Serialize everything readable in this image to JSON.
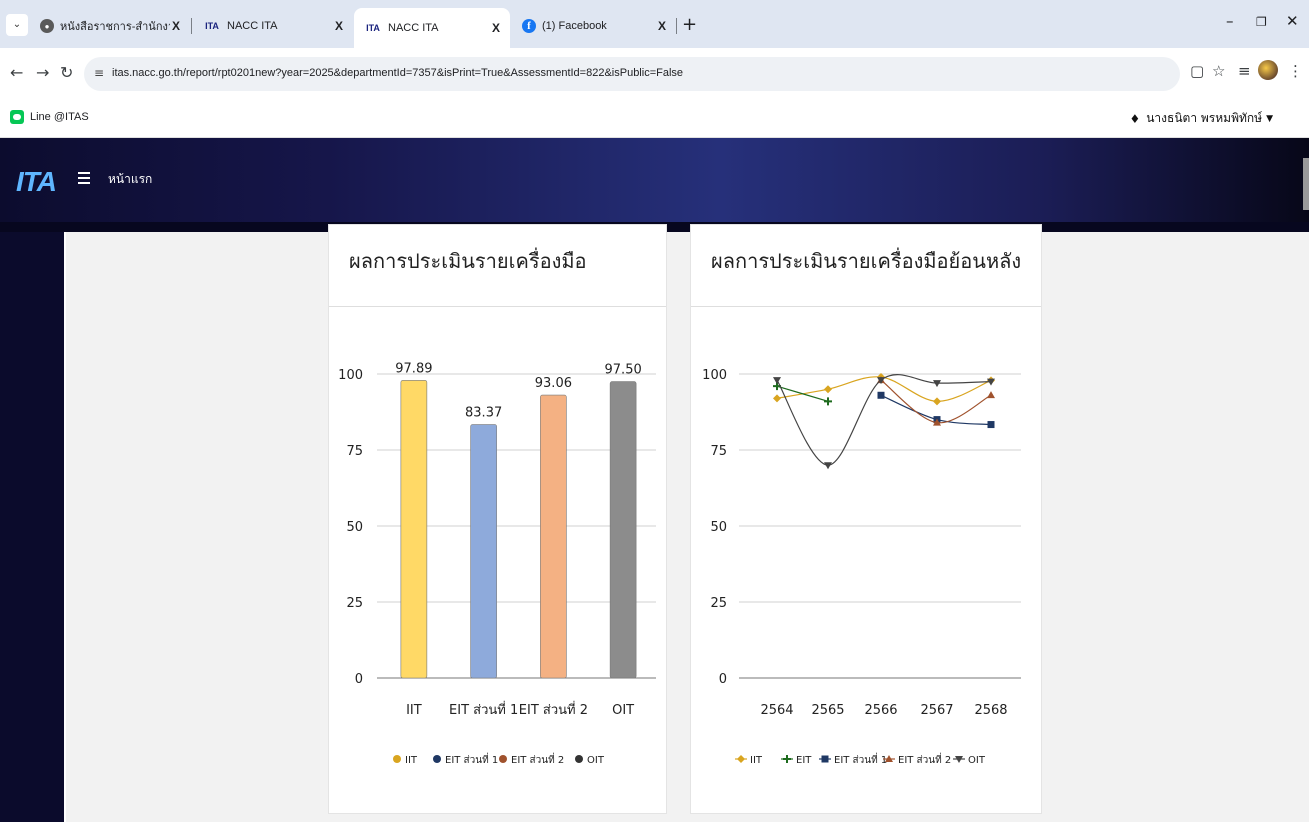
{
  "browser": {
    "tabs": [
      {
        "title": "หนังสือราชการ-สำนักงานส่งเสริมการ",
        "icon": "government-seal-icon",
        "active": false
      },
      {
        "title": "NACC ITA",
        "icon": "itas-logo-icon",
        "active": false
      },
      {
        "title": "NACC ITA",
        "icon": "itas-logo-icon",
        "active": true
      },
      {
        "title": "(1) Facebook",
        "icon": "facebook-icon",
        "active": false
      }
    ],
    "tab_close": "X",
    "new_tab": "+",
    "url": "itas.nacc.go.th/report/rpt0201new?year=2025&departmentId=7357&isPrint=True&AssessmentId=822&isPublic=False",
    "bookmark": "Line @ITAS",
    "user_name": "นางธนิตา พรหมพิทักษ์"
  },
  "navbar": {
    "logo_text": "ITA",
    "home_label": "หน้าแรก"
  },
  "cards": {
    "bar_title": "ผลการประเมินรายเครื่องมือ",
    "line_title": "ผลการประเมินรายเครื่องมือย้อนหลัง"
  },
  "chart_data": [
    {
      "type": "bar",
      "title": "ผลการประเมินรายเครื่องมือ",
      "categories": [
        "IIT",
        "EIT ส่วนที่ 1",
        "EIT ส่วนที่ 2",
        "OIT"
      ],
      "values": [
        97.89,
        83.37,
        93.06,
        97.5
      ],
      "value_labels": [
        "97.89",
        "83.37",
        "93.06",
        "97.50"
      ],
      "colors": [
        "#ffd966",
        "#8eaadb",
        "#f4b183",
        "#8c8c8c"
      ],
      "legend_colors": [
        "#d9a520",
        "#1f3864",
        "#a0522d",
        "#333333"
      ],
      "ylim": [
        0,
        100
      ],
      "yticks": [
        0,
        25,
        50,
        75,
        100
      ],
      "grid": true,
      "legend": "bottom"
    },
    {
      "type": "line",
      "title": "ผลการประเมินรายเครื่องมือย้อนหลัง",
      "x": [
        "2564",
        "2565",
        "2566",
        "2567",
        "2568"
      ],
      "ylim": [
        0,
        100
      ],
      "yticks": [
        0,
        25,
        50,
        75,
        100
      ],
      "grid": true,
      "legend": "bottom",
      "series": [
        {
          "name": "IIT",
          "color": "#d9a520",
          "marker": "diamond",
          "values": [
            92,
            95,
            99,
            91,
            97.89
          ]
        },
        {
          "name": "EIT",
          "color": "#1e6b1e",
          "marker": "plus",
          "values": [
            96,
            91,
            null,
            null,
            null
          ]
        },
        {
          "name": "EIT ส่วนที่ 1",
          "color": "#1f3864",
          "marker": "square",
          "values": [
            null,
            null,
            93,
            85,
            83.37
          ]
        },
        {
          "name": "EIT ส่วนที่ 2",
          "color": "#a0522d",
          "marker": "triangle",
          "values": [
            null,
            null,
            98,
            84,
            93.06
          ]
        },
        {
          "name": "OIT",
          "color": "#444444",
          "marker": "tdown",
          "values": [
            98,
            70,
            98,
            97,
            97.5
          ]
        }
      ]
    }
  ]
}
